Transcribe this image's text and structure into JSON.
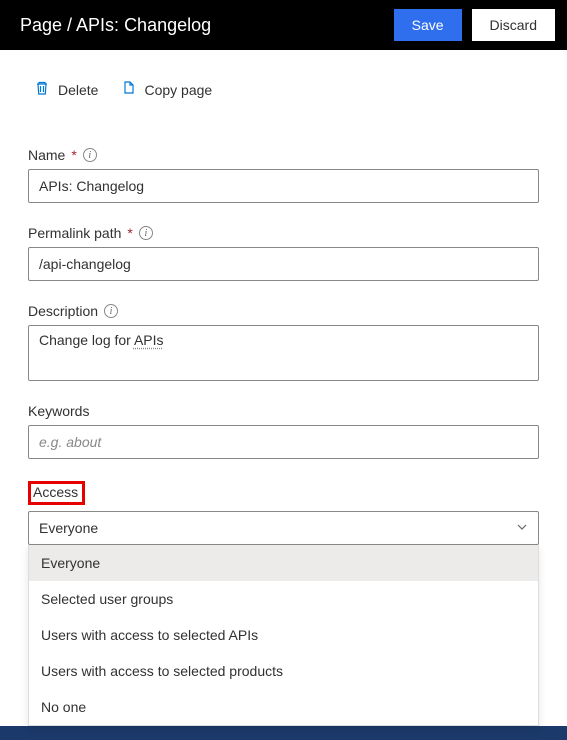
{
  "header": {
    "title": "Page / APIs: Changelog",
    "save_label": "Save",
    "discard_label": "Discard"
  },
  "toolbar": {
    "delete_label": "Delete",
    "copy_label": "Copy page"
  },
  "form": {
    "name": {
      "label": "Name",
      "value": "APIs: Changelog"
    },
    "permalink": {
      "label": "Permalink path",
      "value": "/api-changelog"
    },
    "description": {
      "label": "Description",
      "value_prefix": "Change log for ",
      "value_underlined": "APIs"
    },
    "keywords": {
      "label": "Keywords",
      "placeholder": "e.g. about",
      "value": ""
    },
    "access": {
      "label": "Access",
      "selected": "Everyone",
      "options": [
        "Everyone",
        "Selected user groups",
        "Users with access to selected APIs",
        "Users with access to selected products",
        "No one"
      ]
    }
  }
}
